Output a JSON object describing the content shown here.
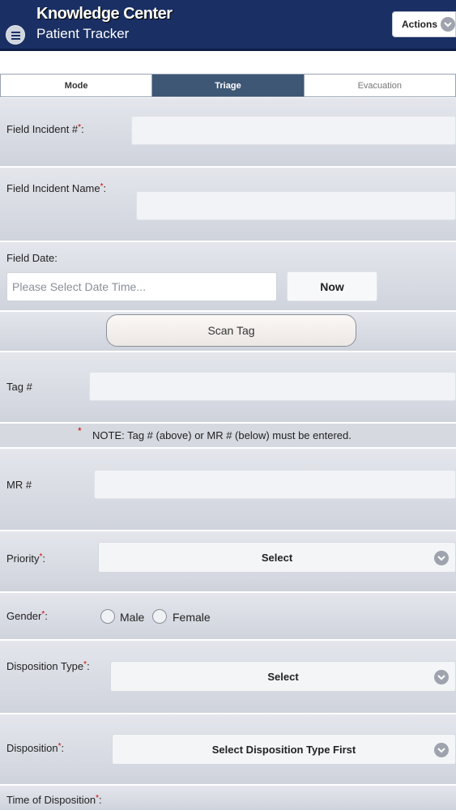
{
  "header": {
    "app_title": "Knowledge Center",
    "app_subtitle": "Patient Tracker",
    "actions_label": "Actions"
  },
  "tabs": [
    {
      "label": "Mode"
    },
    {
      "label": "Triage"
    },
    {
      "label": "Evacuation"
    }
  ],
  "form": {
    "field_incident_number_label": "Field Incident #",
    "field_incident_name_label": "Field Incident Name",
    "field_date_label": "Field Date:",
    "field_date_placeholder": "Please Select Date Time...",
    "now_button": "Now",
    "scan_tag_button": "Scan Tag",
    "tag_label": "Tag #",
    "note_text": "NOTE: Tag # (above) or MR # (below) must be entered.",
    "mr_label": "MR #",
    "priority_label": "Priority",
    "priority_value": "Select",
    "gender_label": "Gender",
    "gender_options": [
      "Male",
      "Female"
    ],
    "disposition_type_label": "Disposition Type",
    "disposition_type_value": "Select",
    "disposition_label": "Disposition",
    "disposition_value": "Select Disposition Type First",
    "time_of_disposition_label": "Time of Disposition",
    "required_mark": "*",
    "label_suffix": ":"
  }
}
